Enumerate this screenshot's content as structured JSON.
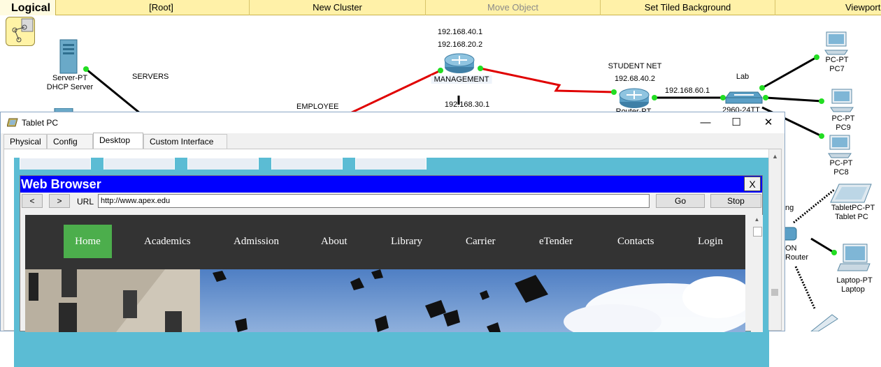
{
  "toolbar": {
    "logical": "Logical",
    "items": [
      {
        "label": "[Root]",
        "disabled": false
      },
      {
        "label": "New Cluster",
        "disabled": false
      },
      {
        "label": "Move Object",
        "disabled": true
      },
      {
        "label": "Set Tiled Background",
        "disabled": false
      },
      {
        "label": "Viewport",
        "disabled": false
      }
    ]
  },
  "topology": {
    "server_type": "Server-PT",
    "server_name": "DHCP Server",
    "servers_label": "SERVERS",
    "employee_label": "EMPLOYEE",
    "mgmt_ip1": "192.168.40.1",
    "mgmt_ip2": "192.168.20.2",
    "mgmt_name": "MANAGEMENT",
    "mgmt_ip3": "192.168.30.1",
    "student_label": "STUDENT NET",
    "student_ip": "192.68.40.2",
    "student_router": "Router-PT",
    "link_ip": "192.168.60.1",
    "lab_label": "Lab",
    "switch_name": "2960-24TT",
    "pc7_type": "PC-PT",
    "pc7_name": "PC7",
    "pc9_type": "PC-PT",
    "pc9_name": "PC9",
    "pc8_type": "PC-PT",
    "pc8_name": "PC8",
    "tablet_type": "TabletPC-PT",
    "tablet_name": "Tablet PC",
    "wrt_fragment1": "ng",
    "wrt_fragment2": "ON",
    "wrt_fragment3": "Router",
    "laptop_type": "Laptop-PT",
    "laptop_name": "Laptop"
  },
  "tablet_window": {
    "title": "Tablet PC",
    "tabs": [
      {
        "label": "Physical",
        "active": false
      },
      {
        "label": "Config",
        "active": false
      },
      {
        "label": "Desktop",
        "active": true
      },
      {
        "label": "Custom Interface",
        "active": false
      }
    ],
    "controls": {
      "minimize": "—",
      "maximize": "☐",
      "close": "✕"
    }
  },
  "browser": {
    "title": "Web Browser",
    "close": "X",
    "back": "<",
    "forward": ">",
    "url_label": "URL",
    "url": "http://www.apex.edu",
    "go": "Go",
    "stop": "Stop"
  },
  "site": {
    "nav": [
      {
        "label": "Home",
        "active": true
      },
      {
        "label": "Academics"
      },
      {
        "label": "Admission"
      },
      {
        "label": "About"
      },
      {
        "label": "Library"
      },
      {
        "label": "Carrier"
      },
      {
        "label": "eTender"
      },
      {
        "label": "Contacts"
      },
      {
        "label": "Login"
      }
    ],
    "colors": {
      "nav_bg": "#333333",
      "active_bg": "#4cae4c",
      "link_serial": "#e00000",
      "link_ok": "#22dd22"
    }
  }
}
